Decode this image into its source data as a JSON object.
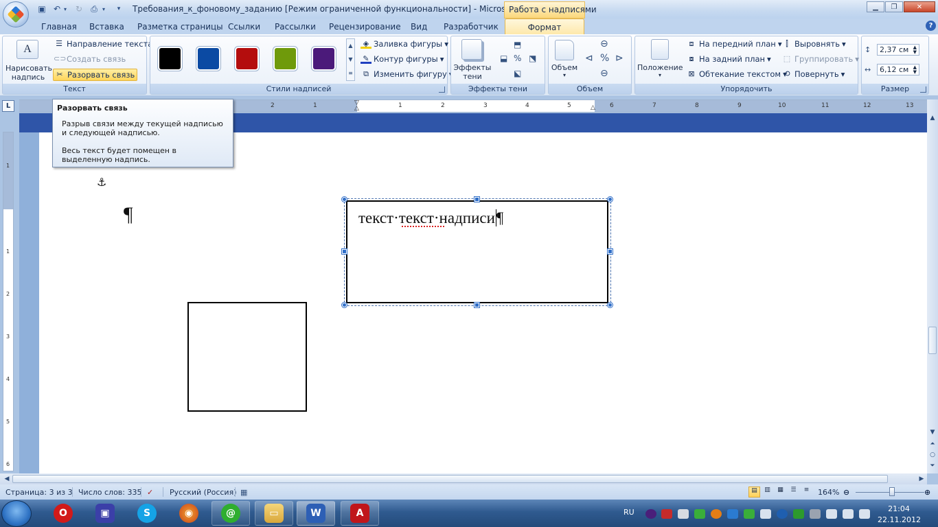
{
  "titlebar": {
    "title": "Требования_к_фоновому_заданию [Режим ограниченной функциональности] - Microsoft W...",
    "context_title": "Работа с надписями"
  },
  "tabs": [
    "Главная",
    "Вставка",
    "Разметка страницы",
    "Ссылки",
    "Рассылки",
    "Рецензирование",
    "Вид",
    "Разработчик"
  ],
  "active_tab": "Формат",
  "ribbon": {
    "text_group": {
      "label": "Текст",
      "draw_textbox": [
        "Нарисовать",
        "надпись"
      ],
      "text_direction": "Направление текста",
      "create_link": "Создать связь",
      "break_link": "Разорвать связь"
    },
    "styles_group": {
      "label": "Стили надписей",
      "swatches": [
        "#000000",
        "#0b4aa3",
        "#b40d0d",
        "#6f9a0b",
        "#4b1a7a"
      ],
      "shape_fill": "Заливка фигуры",
      "shape_outline": "Контур фигуры",
      "change_shape": "Изменить фигуру"
    },
    "shadow_group": {
      "label": "Эффекты тени",
      "shadow_effects": [
        "Эффекты",
        "тени"
      ]
    },
    "volume_group": {
      "label": "Объем",
      "volume": "Объем"
    },
    "arrange_group": {
      "label": "Упорядочить",
      "position": "Положение",
      "bring_front": "На передний план",
      "send_back": "На задний план",
      "text_wrap": "Обтекание текстом",
      "align": "Выровнять",
      "group": "Группировать",
      "rotate": "Повернуть"
    },
    "size_group": {
      "label": "Размер",
      "height": "2,37 см",
      "width": "6,12 см"
    }
  },
  "ruler": {
    "corner": "L",
    "h_numbers": [
      "2",
      "1",
      "1",
      "2",
      "3",
      "4",
      "5",
      "6",
      "7",
      "8",
      "9",
      "10",
      "11",
      "12",
      "13"
    ],
    "v_numbers": [
      "1",
      "1",
      "2",
      "3",
      "4",
      "5",
      "6"
    ]
  },
  "tooltip": {
    "title": "Разорвать связь",
    "line1": "Разрыв связи между текущей надписью и следующей надписью.",
    "line2": "Весь текст будет помещен в выделенную надпись."
  },
  "document": {
    "textbox_text": "текст·текст·надписи",
    "pilcrow": "¶",
    "anchor": "⚓"
  },
  "status": {
    "page": "Страница: 3 из 3",
    "words": "Число слов: 335",
    "language": "Русский (Россия)",
    "zoom": "164%"
  },
  "taskbar": {
    "lang": "RU",
    "time": "21:04",
    "date": "22.11.2012"
  }
}
